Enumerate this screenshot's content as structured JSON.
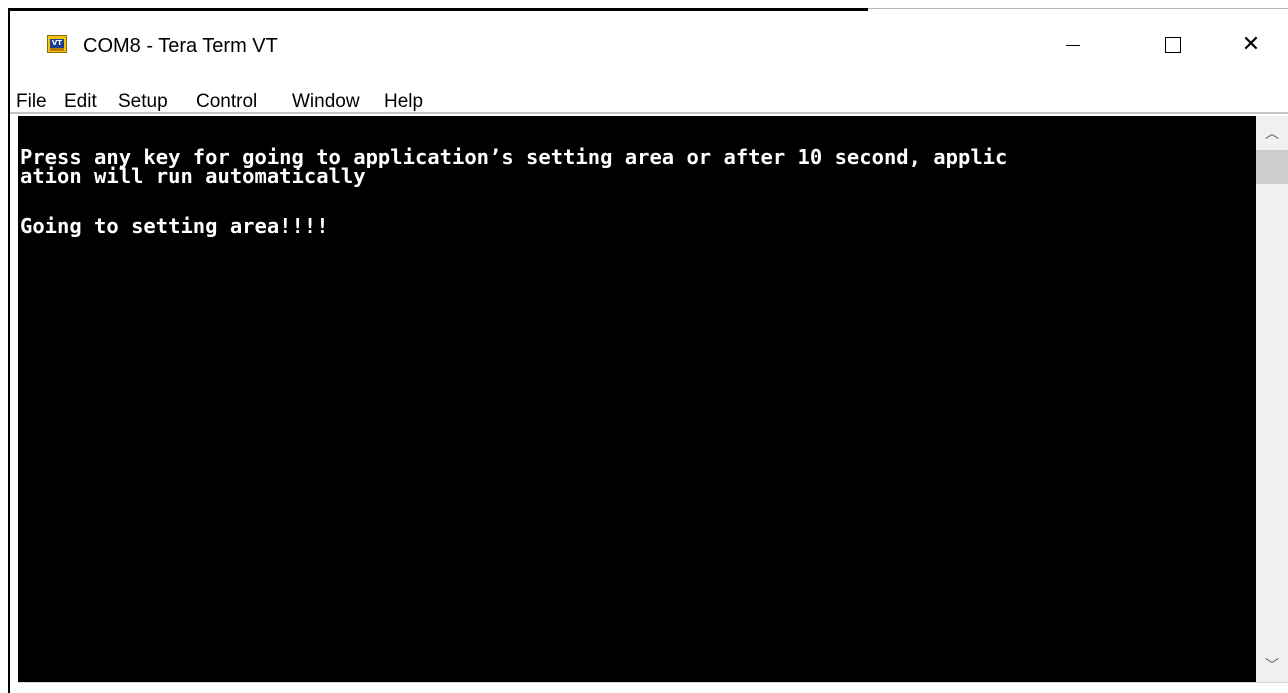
{
  "window": {
    "title": "COM8 - Tera Term VT",
    "icon": "teraterm-vt-icon",
    "controls": {
      "minimize": "minimize-icon",
      "maximize": "maximize-icon",
      "close": "close-icon"
    }
  },
  "menubar": {
    "items": [
      {
        "label": "File"
      },
      {
        "label": "Edit"
      },
      {
        "label": "Setup"
      },
      {
        "label": "Control"
      },
      {
        "label": "Window"
      },
      {
        "label": "Help"
      }
    ]
  },
  "terminal": {
    "lines": [
      "Press any key for going to application’s setting area or after 10 second, applic",
      "ation will run automatically",
      "",
      "Going to setting area!!!!"
    ],
    "foreground": "#ffffff",
    "background": "#000000"
  },
  "scrollbar": {
    "up_icon": "chevron-up-icon",
    "down_icon": "chevron-down-icon"
  }
}
